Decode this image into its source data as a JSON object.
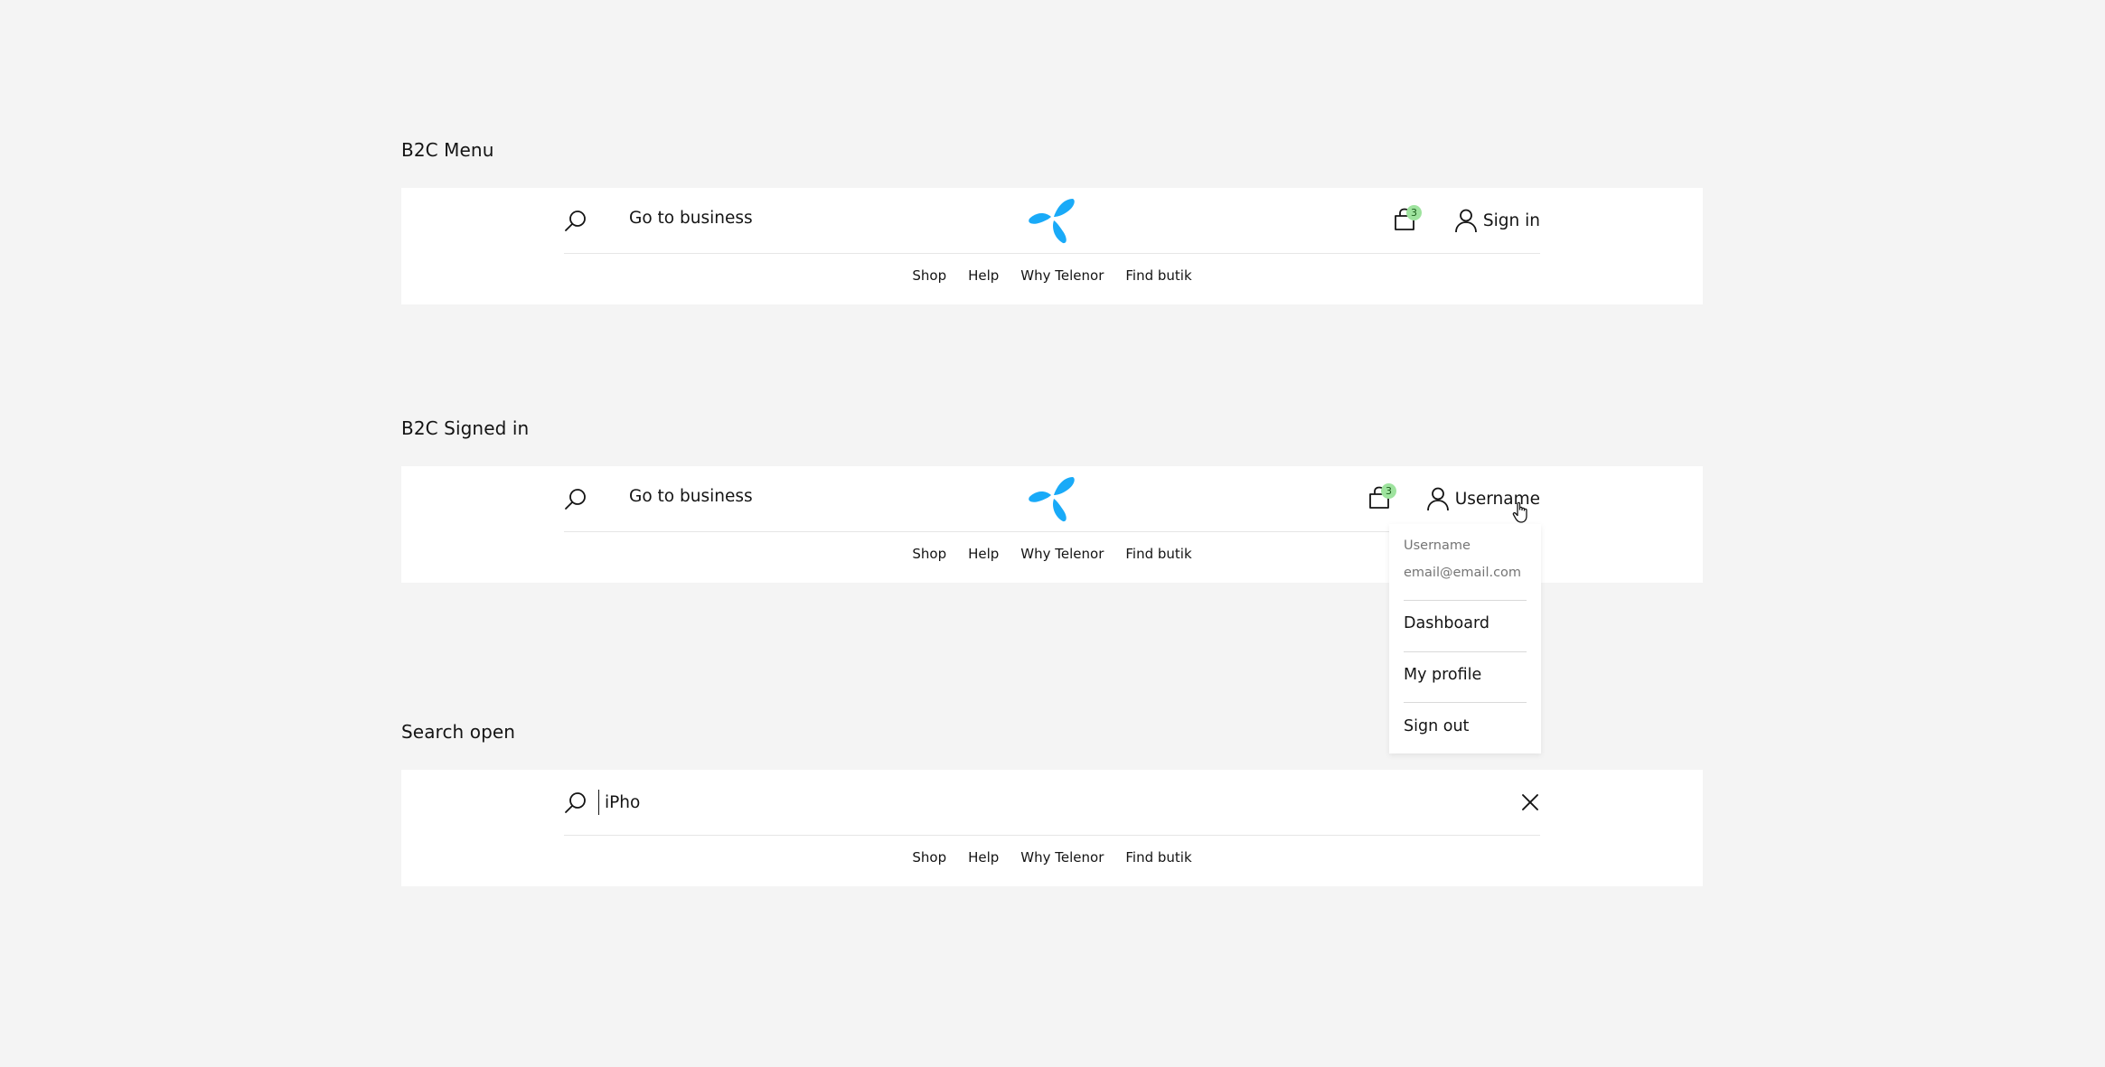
{
  "sections": [
    {
      "title": "B2C Menu",
      "go_to_business": "Go to business",
      "cart_count": "3",
      "account_label": "Sign in",
      "nav": [
        "Shop",
        "Help",
        "Why Telenor",
        "Find butik"
      ]
    },
    {
      "title": "B2C Signed in",
      "go_to_business": "Go to business",
      "cart_count": "3",
      "account_label": "Username",
      "nav": [
        "Shop",
        "Help",
        "Why Telenor",
        "Find butik"
      ],
      "dropdown": {
        "username": "Username",
        "email": "email@email.com",
        "items": [
          "Dashboard",
          "My profile",
          "Sign out"
        ]
      }
    },
    {
      "title": "Search open",
      "search_value": "iPho",
      "nav": [
        "Shop",
        "Help",
        "Why Telenor",
        "Find butik"
      ]
    }
  ],
  "colors": {
    "page_background": "#f4f4f4",
    "header_background": "#ffffff",
    "brand_blue": "#19aaf8",
    "badge_green": "#9ee39e",
    "text": "#141414",
    "muted_text": "#757575"
  },
  "icons": [
    "search-icon",
    "telenor-logo",
    "shopping-bag-icon",
    "user-icon",
    "close-icon",
    "hand-cursor-icon"
  ]
}
